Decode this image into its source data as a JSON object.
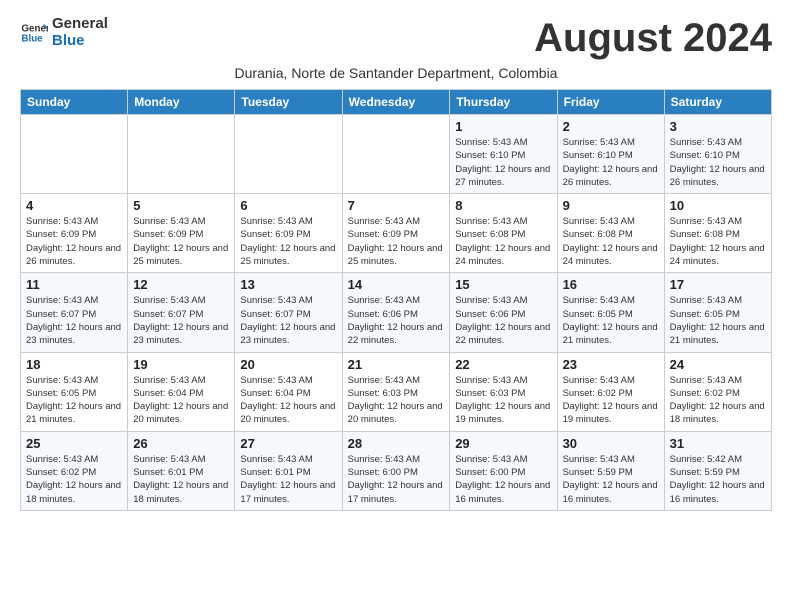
{
  "header": {
    "logo_line1": "General",
    "logo_line2": "Blue",
    "month_year": "August 2024",
    "subtitle": "Durania, Norte de Santander Department, Colombia"
  },
  "weekdays": [
    "Sunday",
    "Monday",
    "Tuesday",
    "Wednesday",
    "Thursday",
    "Friday",
    "Saturday"
  ],
  "weeks": [
    [
      {
        "day": "",
        "info": ""
      },
      {
        "day": "",
        "info": ""
      },
      {
        "day": "",
        "info": ""
      },
      {
        "day": "",
        "info": ""
      },
      {
        "day": "1",
        "info": "Sunrise: 5:43 AM\nSunset: 6:10 PM\nDaylight: 12 hours\nand 27 minutes."
      },
      {
        "day": "2",
        "info": "Sunrise: 5:43 AM\nSunset: 6:10 PM\nDaylight: 12 hours\nand 26 minutes."
      },
      {
        "day": "3",
        "info": "Sunrise: 5:43 AM\nSunset: 6:10 PM\nDaylight: 12 hours\nand 26 minutes."
      }
    ],
    [
      {
        "day": "4",
        "info": "Sunrise: 5:43 AM\nSunset: 6:09 PM\nDaylight: 12 hours\nand 26 minutes."
      },
      {
        "day": "5",
        "info": "Sunrise: 5:43 AM\nSunset: 6:09 PM\nDaylight: 12 hours\nand 25 minutes."
      },
      {
        "day": "6",
        "info": "Sunrise: 5:43 AM\nSunset: 6:09 PM\nDaylight: 12 hours\nand 25 minutes."
      },
      {
        "day": "7",
        "info": "Sunrise: 5:43 AM\nSunset: 6:09 PM\nDaylight: 12 hours\nand 25 minutes."
      },
      {
        "day": "8",
        "info": "Sunrise: 5:43 AM\nSunset: 6:08 PM\nDaylight: 12 hours\nand 24 minutes."
      },
      {
        "day": "9",
        "info": "Sunrise: 5:43 AM\nSunset: 6:08 PM\nDaylight: 12 hours\nand 24 minutes."
      },
      {
        "day": "10",
        "info": "Sunrise: 5:43 AM\nSunset: 6:08 PM\nDaylight: 12 hours\nand 24 minutes."
      }
    ],
    [
      {
        "day": "11",
        "info": "Sunrise: 5:43 AM\nSunset: 6:07 PM\nDaylight: 12 hours\nand 23 minutes."
      },
      {
        "day": "12",
        "info": "Sunrise: 5:43 AM\nSunset: 6:07 PM\nDaylight: 12 hours\nand 23 minutes."
      },
      {
        "day": "13",
        "info": "Sunrise: 5:43 AM\nSunset: 6:07 PM\nDaylight: 12 hours\nand 23 minutes."
      },
      {
        "day": "14",
        "info": "Sunrise: 5:43 AM\nSunset: 6:06 PM\nDaylight: 12 hours\nand 22 minutes."
      },
      {
        "day": "15",
        "info": "Sunrise: 5:43 AM\nSunset: 6:06 PM\nDaylight: 12 hours\nand 22 minutes."
      },
      {
        "day": "16",
        "info": "Sunrise: 5:43 AM\nSunset: 6:05 PM\nDaylight: 12 hours\nand 21 minutes."
      },
      {
        "day": "17",
        "info": "Sunrise: 5:43 AM\nSunset: 6:05 PM\nDaylight: 12 hours\nand 21 minutes."
      }
    ],
    [
      {
        "day": "18",
        "info": "Sunrise: 5:43 AM\nSunset: 6:05 PM\nDaylight: 12 hours\nand 21 minutes."
      },
      {
        "day": "19",
        "info": "Sunrise: 5:43 AM\nSunset: 6:04 PM\nDaylight: 12 hours\nand 20 minutes."
      },
      {
        "day": "20",
        "info": "Sunrise: 5:43 AM\nSunset: 6:04 PM\nDaylight: 12 hours\nand 20 minutes."
      },
      {
        "day": "21",
        "info": "Sunrise: 5:43 AM\nSunset: 6:03 PM\nDaylight: 12 hours\nand 20 minutes."
      },
      {
        "day": "22",
        "info": "Sunrise: 5:43 AM\nSunset: 6:03 PM\nDaylight: 12 hours\nand 19 minutes."
      },
      {
        "day": "23",
        "info": "Sunrise: 5:43 AM\nSunset: 6:02 PM\nDaylight: 12 hours\nand 19 minutes."
      },
      {
        "day": "24",
        "info": "Sunrise: 5:43 AM\nSunset: 6:02 PM\nDaylight: 12 hours\nand 18 minutes."
      }
    ],
    [
      {
        "day": "25",
        "info": "Sunrise: 5:43 AM\nSunset: 6:02 PM\nDaylight: 12 hours\nand 18 minutes."
      },
      {
        "day": "26",
        "info": "Sunrise: 5:43 AM\nSunset: 6:01 PM\nDaylight: 12 hours\nand 18 minutes."
      },
      {
        "day": "27",
        "info": "Sunrise: 5:43 AM\nSunset: 6:01 PM\nDaylight: 12 hours\nand 17 minutes."
      },
      {
        "day": "28",
        "info": "Sunrise: 5:43 AM\nSunset: 6:00 PM\nDaylight: 12 hours\nand 17 minutes."
      },
      {
        "day": "29",
        "info": "Sunrise: 5:43 AM\nSunset: 6:00 PM\nDaylight: 12 hours\nand 16 minutes."
      },
      {
        "day": "30",
        "info": "Sunrise: 5:43 AM\nSunset: 5:59 PM\nDaylight: 12 hours\nand 16 minutes."
      },
      {
        "day": "31",
        "info": "Sunrise: 5:42 AM\nSunset: 5:59 PM\nDaylight: 12 hours\nand 16 minutes."
      }
    ]
  ]
}
